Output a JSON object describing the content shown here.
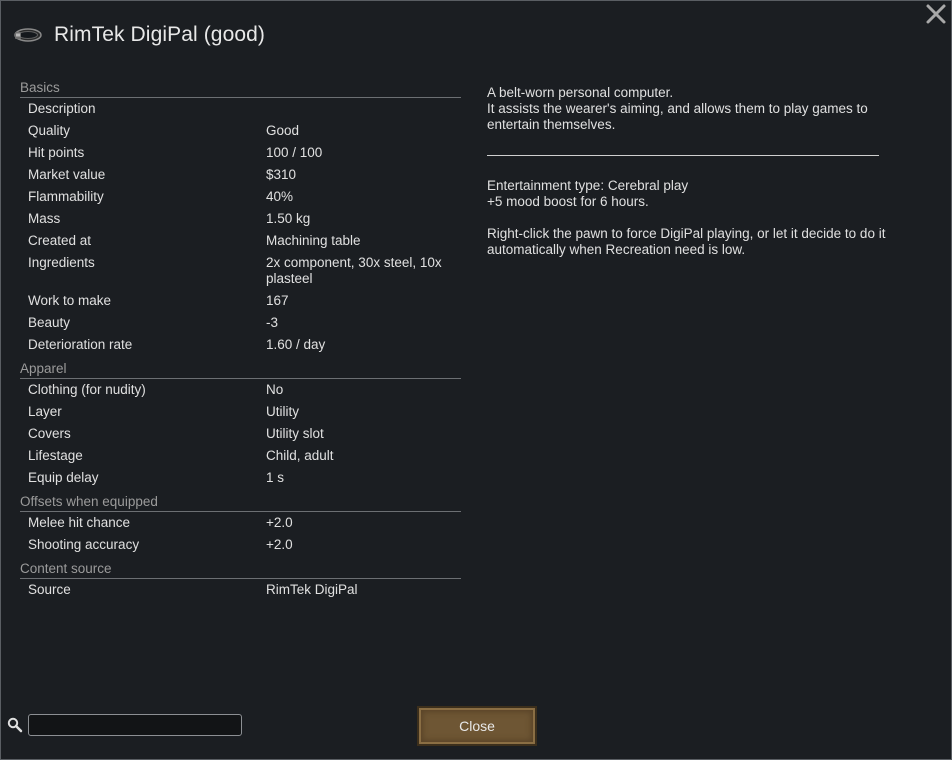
{
  "title": "RimTek DigiPal (good)",
  "icons": {
    "item": "belt-computer-icon",
    "close": "close-icon",
    "search": "search-icon"
  },
  "stats": [
    {
      "category": "Basics",
      "rows": [
        {
          "label": "Description",
          "value": ""
        },
        {
          "label": "Quality",
          "value": "Good"
        },
        {
          "label": "Hit points",
          "value": "100 / 100"
        },
        {
          "label": "Market value",
          "value": "$310"
        },
        {
          "label": "Flammability",
          "value": "40%"
        },
        {
          "label": "Mass",
          "value": "1.50 kg"
        },
        {
          "label": "Created at",
          "value": "Machining table"
        },
        {
          "label": "Ingredients",
          "value": "2x component, 30x steel, 10x plasteel"
        },
        {
          "label": "Work to make",
          "value": "167"
        },
        {
          "label": "Beauty",
          "value": "-3"
        },
        {
          "label": "Deterioration rate",
          "value": "1.60 / day"
        }
      ]
    },
    {
      "category": "Apparel",
      "rows": [
        {
          "label": "Clothing (for nudity)",
          "value": "No"
        },
        {
          "label": "Layer",
          "value": "Utility"
        },
        {
          "label": "Covers",
          "value": "Utility slot"
        },
        {
          "label": "Lifestage",
          "value": "Child, adult"
        },
        {
          "label": "Equip delay",
          "value": "1 s"
        }
      ]
    },
    {
      "category": "Offsets when equipped",
      "rows": [
        {
          "label": "Melee hit chance",
          "value": "+2.0"
        },
        {
          "label": "Shooting accuracy",
          "value": "+2.0"
        }
      ]
    },
    {
      "category": "Content source",
      "rows": [
        {
          "label": "Source",
          "value": "RimTek DigiPal"
        }
      ]
    }
  ],
  "description": {
    "line1": "A belt-worn personal computer.",
    "line2": "It assists the wearer's aiming, and allows them to play games to entertain themselves.",
    "entertainment": "Entertainment type: Cerebral play",
    "mood": "+5 mood boost for 6 hours.",
    "hint": "Right-click the pawn to force DigiPal playing, or let it decide to do it automatically when Recreation need is low."
  },
  "search": {
    "value": "",
    "placeholder": ""
  },
  "close_label": "Close",
  "colors": {
    "background": "#1b1e22",
    "category_text": "#9b9b9b",
    "button": "#6e5634"
  }
}
